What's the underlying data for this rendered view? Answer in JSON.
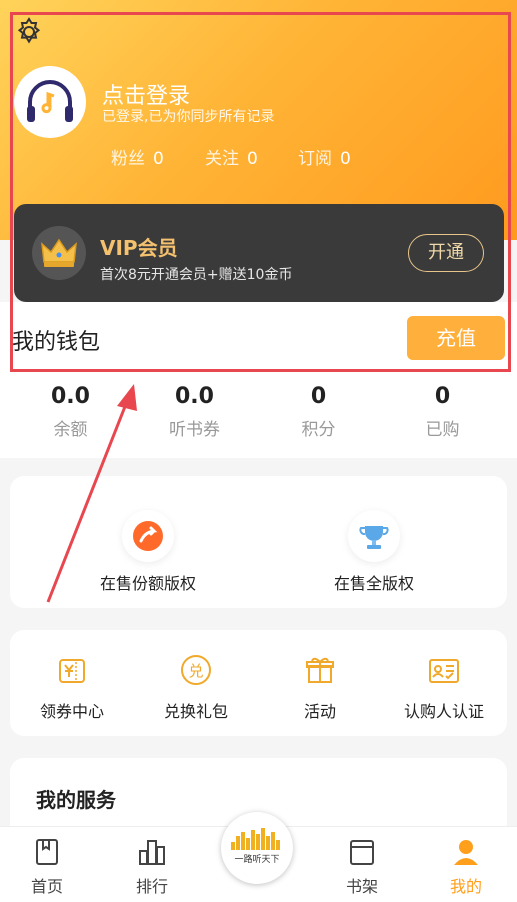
{
  "header": {
    "login_title": "点击登录",
    "login_subtitle": "已登录,已为你同步所有记录",
    "stats": [
      {
        "label": "粉丝",
        "value": "0"
      },
      {
        "label": "关注",
        "value": "0"
      },
      {
        "label": "订阅",
        "value": "0"
      }
    ]
  },
  "vip": {
    "title": "VIP会员",
    "subtitle": "首次8元开通会员+赠送10金币",
    "button": "开通"
  },
  "wallet": {
    "title": "我的钱包",
    "recharge_button": "充值",
    "stats": [
      {
        "value": "0.0",
        "label": "余额"
      },
      {
        "value": "0.0",
        "label": "听书券"
      },
      {
        "value": "0",
        "label": "积分"
      },
      {
        "value": "0",
        "label": "已购"
      }
    ]
  },
  "copyright": {
    "items": [
      {
        "label": "在售份额版权",
        "icon": "share-copyright-icon"
      },
      {
        "label": "在售全版权",
        "icon": "full-copyright-icon"
      }
    ]
  },
  "services_row": {
    "items": [
      {
        "label": "领券中心",
        "icon": "coupon-icon"
      },
      {
        "label": "兑换礼包",
        "icon": "exchange-icon"
      },
      {
        "label": "活动",
        "icon": "gift-icon"
      },
      {
        "label": "认购人认证",
        "icon": "id-card-icon"
      }
    ]
  },
  "my_services": {
    "title": "我的服务"
  },
  "tabbar": {
    "tabs": [
      {
        "label": "首页",
        "icon": "bookmark-icon"
      },
      {
        "label": "排行",
        "icon": "bar-chart-icon"
      },
      {
        "label": "书架",
        "icon": "book-icon"
      },
      {
        "label": "我的",
        "icon": "person-icon",
        "active": true
      }
    ],
    "center_logo_text": "一路听天下"
  },
  "colors": {
    "accent": "#ffaf3b",
    "vip_gold": "#f4c16f",
    "annotation_red": "#e8474f"
  }
}
